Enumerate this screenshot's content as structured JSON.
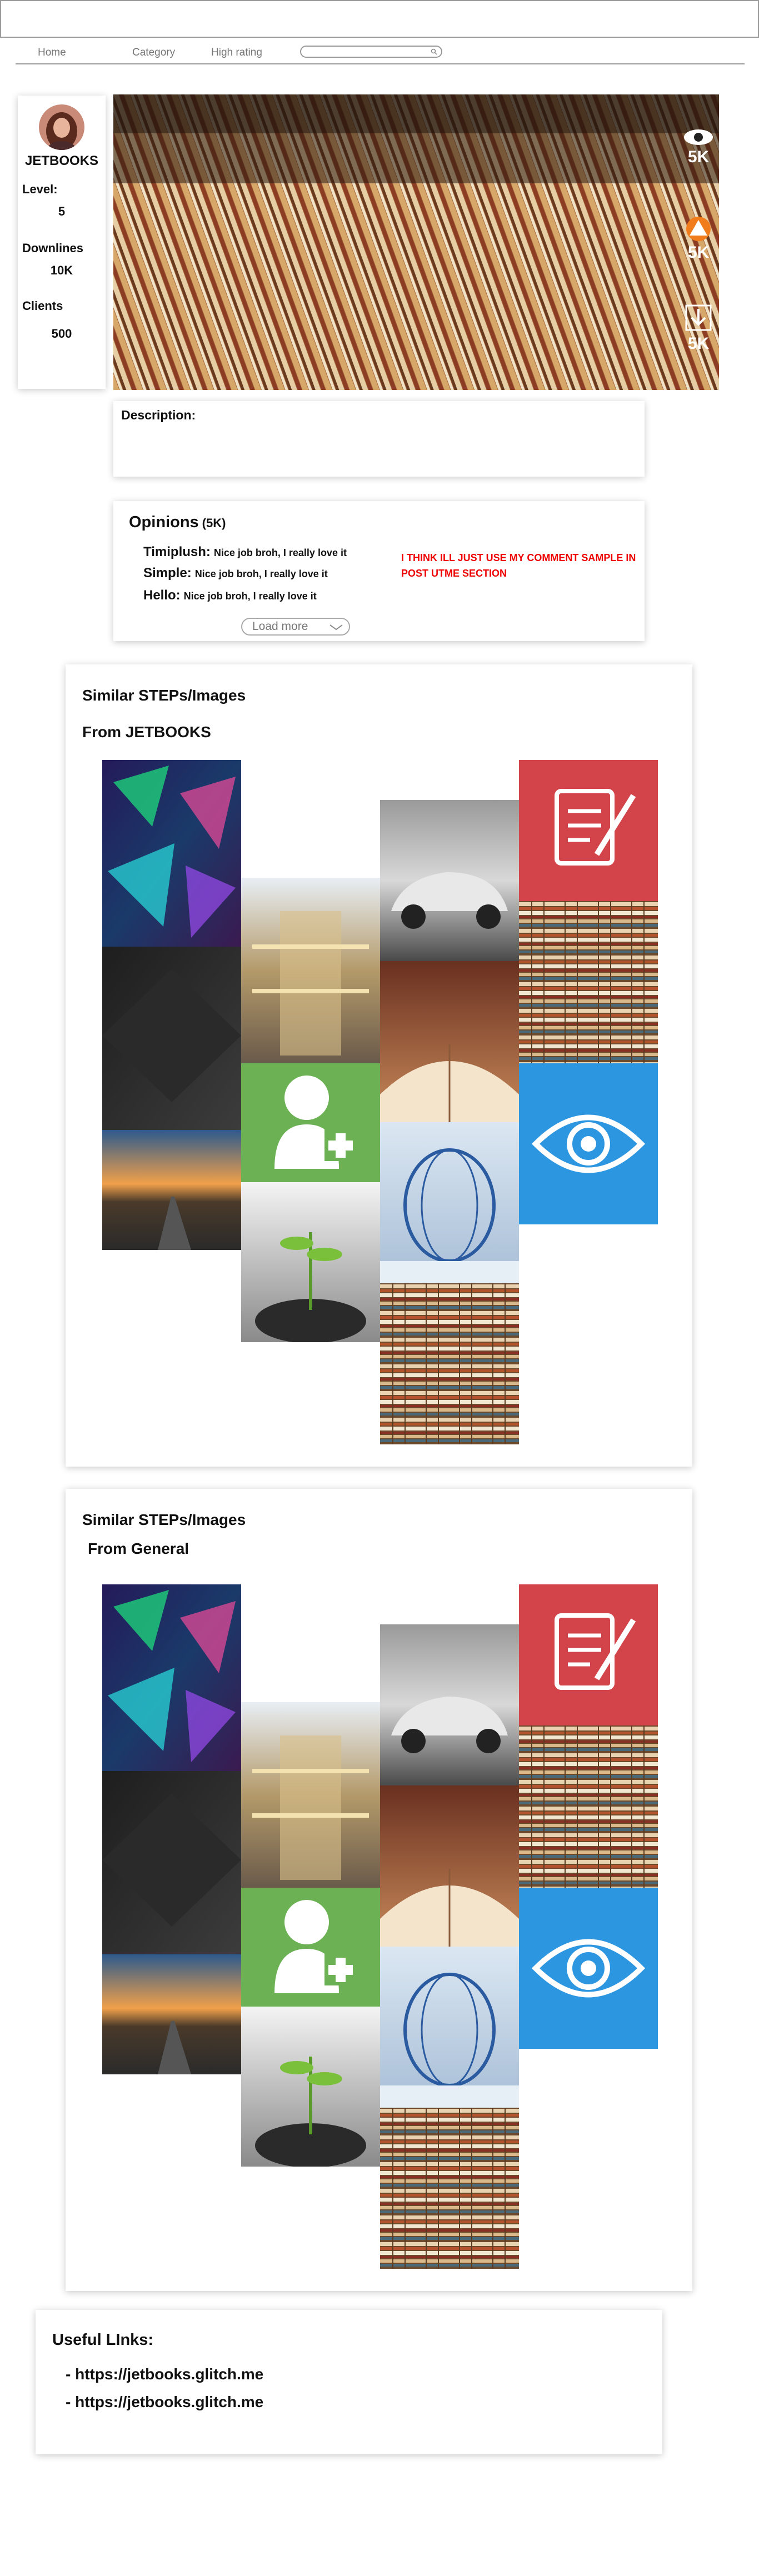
{
  "nav": {
    "home": "Home",
    "category": "Category",
    "high_rating": "High rating",
    "search_placeholder": ""
  },
  "profile": {
    "name": "JETBOOKS",
    "level_label": "Level:",
    "level_value": "5",
    "downlines_label": "Downlines",
    "downlines_value": "10K",
    "clients_label": "Clients",
    "clients_value": "500"
  },
  "hero": {
    "views": "5K",
    "likes": "5K",
    "downloads": "5K"
  },
  "description": {
    "label": "Description:",
    "text": ""
  },
  "opinions": {
    "title": "Opinions",
    "count": "(5K)",
    "comments": [
      {
        "name": "Timiplush:",
        "text": "Nice job broh, I really love it"
      },
      {
        "name": "Simple:",
        "text": "Nice job broh, I really love it"
      },
      {
        "name": "Hello:",
        "text": "Nice job broh, I really love it"
      }
    ],
    "note": "I THINK ILL JUST USE MY COMMENT SAMPLE IN POST UTME SECTION",
    "load_more": "Load more"
  },
  "similar_user": {
    "title": "Similar STEPs/Images",
    "subtitle": "From JETBOOKS"
  },
  "similar_general": {
    "title": "Similar STEPs/Images",
    "subtitle": "From General"
  },
  "useful_links": {
    "title": "Useful LInks:",
    "links": [
      "- https://jetbooks.glitch.me",
      "- https://jetbooks.glitch.me"
    ]
  },
  "colors": {
    "tile_red": "#d2434a",
    "tile_green": "#6cb254",
    "tile_blue": "#2d96e1",
    "note_red": "#e00000"
  }
}
